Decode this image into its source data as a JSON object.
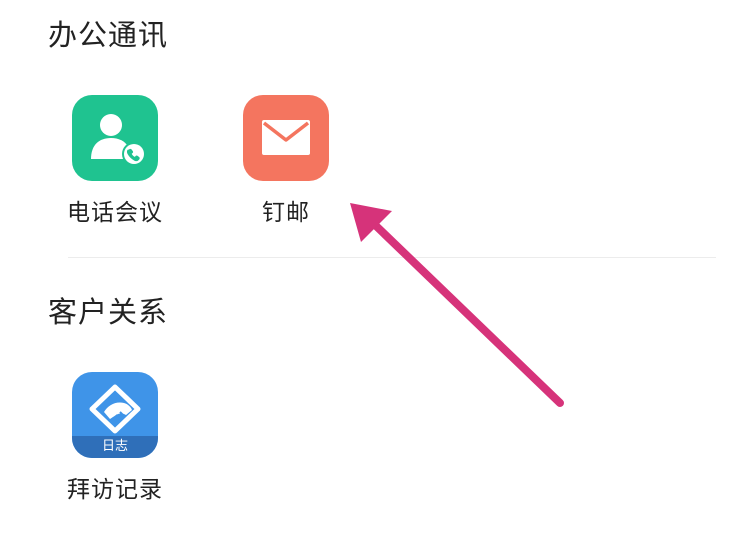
{
  "sections": [
    {
      "title": "办公通讯",
      "apps": [
        {
          "label": "电话会议",
          "icon": "phone-contact-icon",
          "color": "#1fc390"
        },
        {
          "label": "钉邮",
          "icon": "mail-envelope-icon",
          "color": "#f4755f"
        }
      ]
    },
    {
      "title": "客户关系",
      "apps": [
        {
          "label": "拜访记录",
          "icon": "handshake-icon",
          "color": "#3f94e8",
          "badge": "日志"
        }
      ]
    }
  ],
  "annotation": {
    "type": "arrow",
    "color": "#d6337a"
  }
}
